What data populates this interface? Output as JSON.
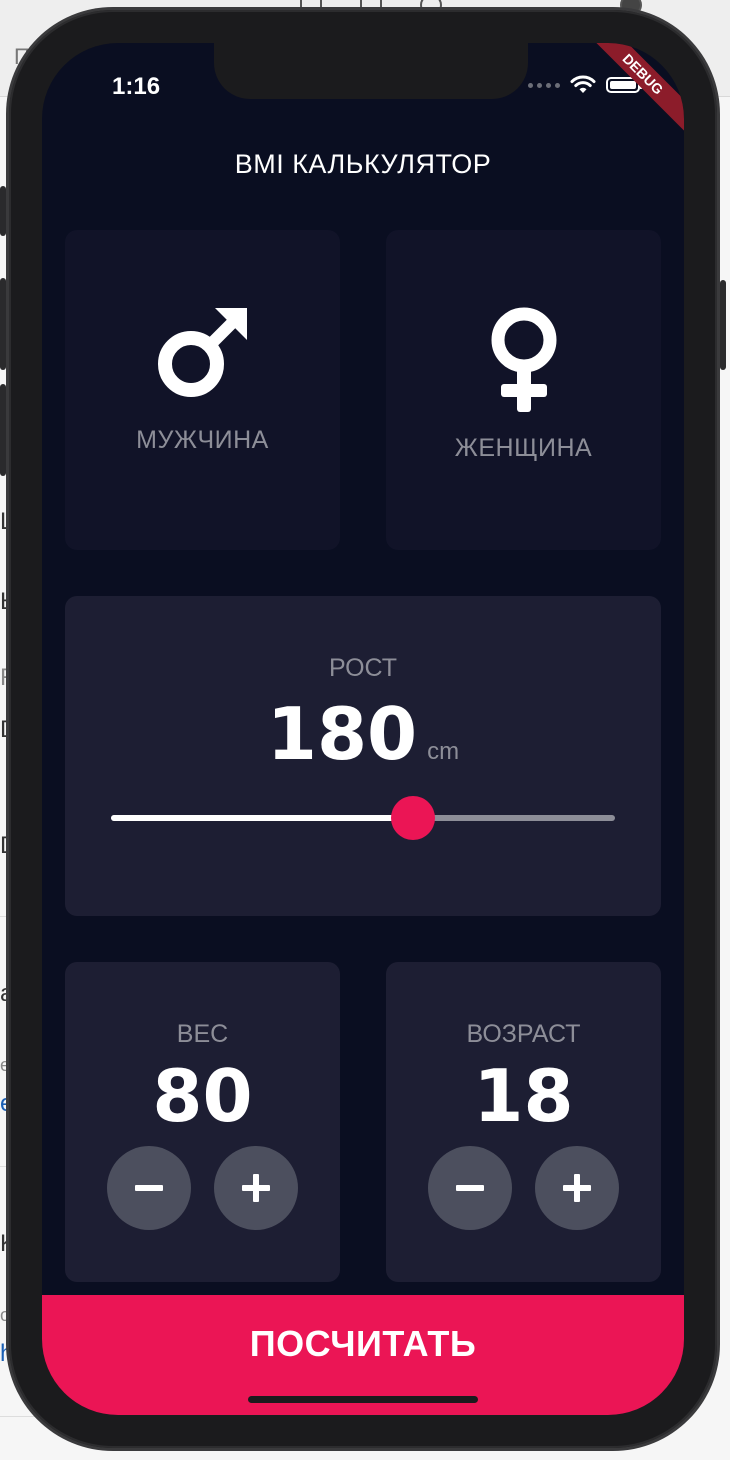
{
  "status_bar": {
    "time": "1:16",
    "debug_banner": "DEBUG"
  },
  "app": {
    "title": "BMI КАЛЬКУЛЯТОР"
  },
  "gender": {
    "male_label": "МУЖЧИНА",
    "female_label": "ЖЕНЩИНА",
    "selected": "none"
  },
  "height": {
    "label": "РОСТ",
    "value": "180",
    "unit": "cm",
    "slider_fraction": 0.6
  },
  "weight": {
    "label": "ВЕС",
    "value": "80",
    "minus": "−",
    "plus": "+"
  },
  "age": {
    "label": "ВОЗРАСТ",
    "value": "18",
    "minus": "−",
    "plus": "+"
  },
  "calculate": {
    "label": "ПОСЧИТАТЬ"
  },
  "colors": {
    "background": "#0a0e21",
    "card_active": "#1d1e33",
    "card_inactive": "#111328",
    "accent": "#eb1555",
    "round_button": "#4c4f5e",
    "label": "#8d8e98"
  },
  "background_page": {
    "tab_text": "П",
    "side_chars": [
      "Ц",
      "Ы",
      "R",
      "D",
      "D",
      "a",
      "e",
      "e",
      "K",
      "o",
      "h"
    ]
  }
}
